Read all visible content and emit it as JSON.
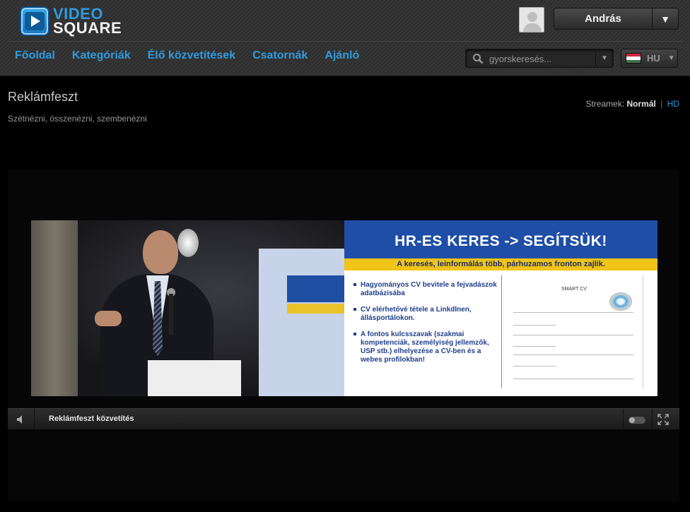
{
  "brand": {
    "line1": "VIDEO",
    "line2": "SQUARE"
  },
  "user": {
    "name": "András"
  },
  "nav": {
    "items": [
      "Főoldal",
      "Kategóriák",
      "Élő közvetítések",
      "Csatornák",
      "Ajánló"
    ]
  },
  "search": {
    "placeholder": "gyorskeresés..."
  },
  "language": {
    "code": "HU"
  },
  "page": {
    "title": "Reklámfeszt",
    "subtitle": "Szétnézni, összenézni, szembenézni"
  },
  "streams": {
    "label": "Streamek:",
    "normal": "Normál",
    "separator": "|",
    "hd": "HD"
  },
  "slide": {
    "heading": "HR-ES KERES -> SEGÍTSÜK!",
    "banner": "A keresés, leinformálás több, párhuzamos fronton zajlik.",
    "bullets": [
      "Hagyományos CV bevitele a fejvadászok adatbázisába",
      "CV elérhetővé tétele a LinkdInen, állásportálokon.",
      "A fontos kulcsszavak (szakmai kompetenciák, személyiség jellemzők, USP stb.) elhelyezése a CV-ben és a webes profilokban!"
    ],
    "doc_title": "SMART CV"
  },
  "player": {
    "title": "Reklámfeszt közvetítés"
  },
  "colors": {
    "accent": "#2f9bde",
    "header_bg": "#333333",
    "slide_blue": "#1f4ea6",
    "slide_yellow": "#f0c419"
  },
  "icons": {
    "logo": "play-icon",
    "search": "search-icon",
    "volume": "volume-icon",
    "fullscreen": "fullscreen-icon",
    "dropdown": "chevron-down-icon",
    "flag": "hungary-flag-icon"
  }
}
